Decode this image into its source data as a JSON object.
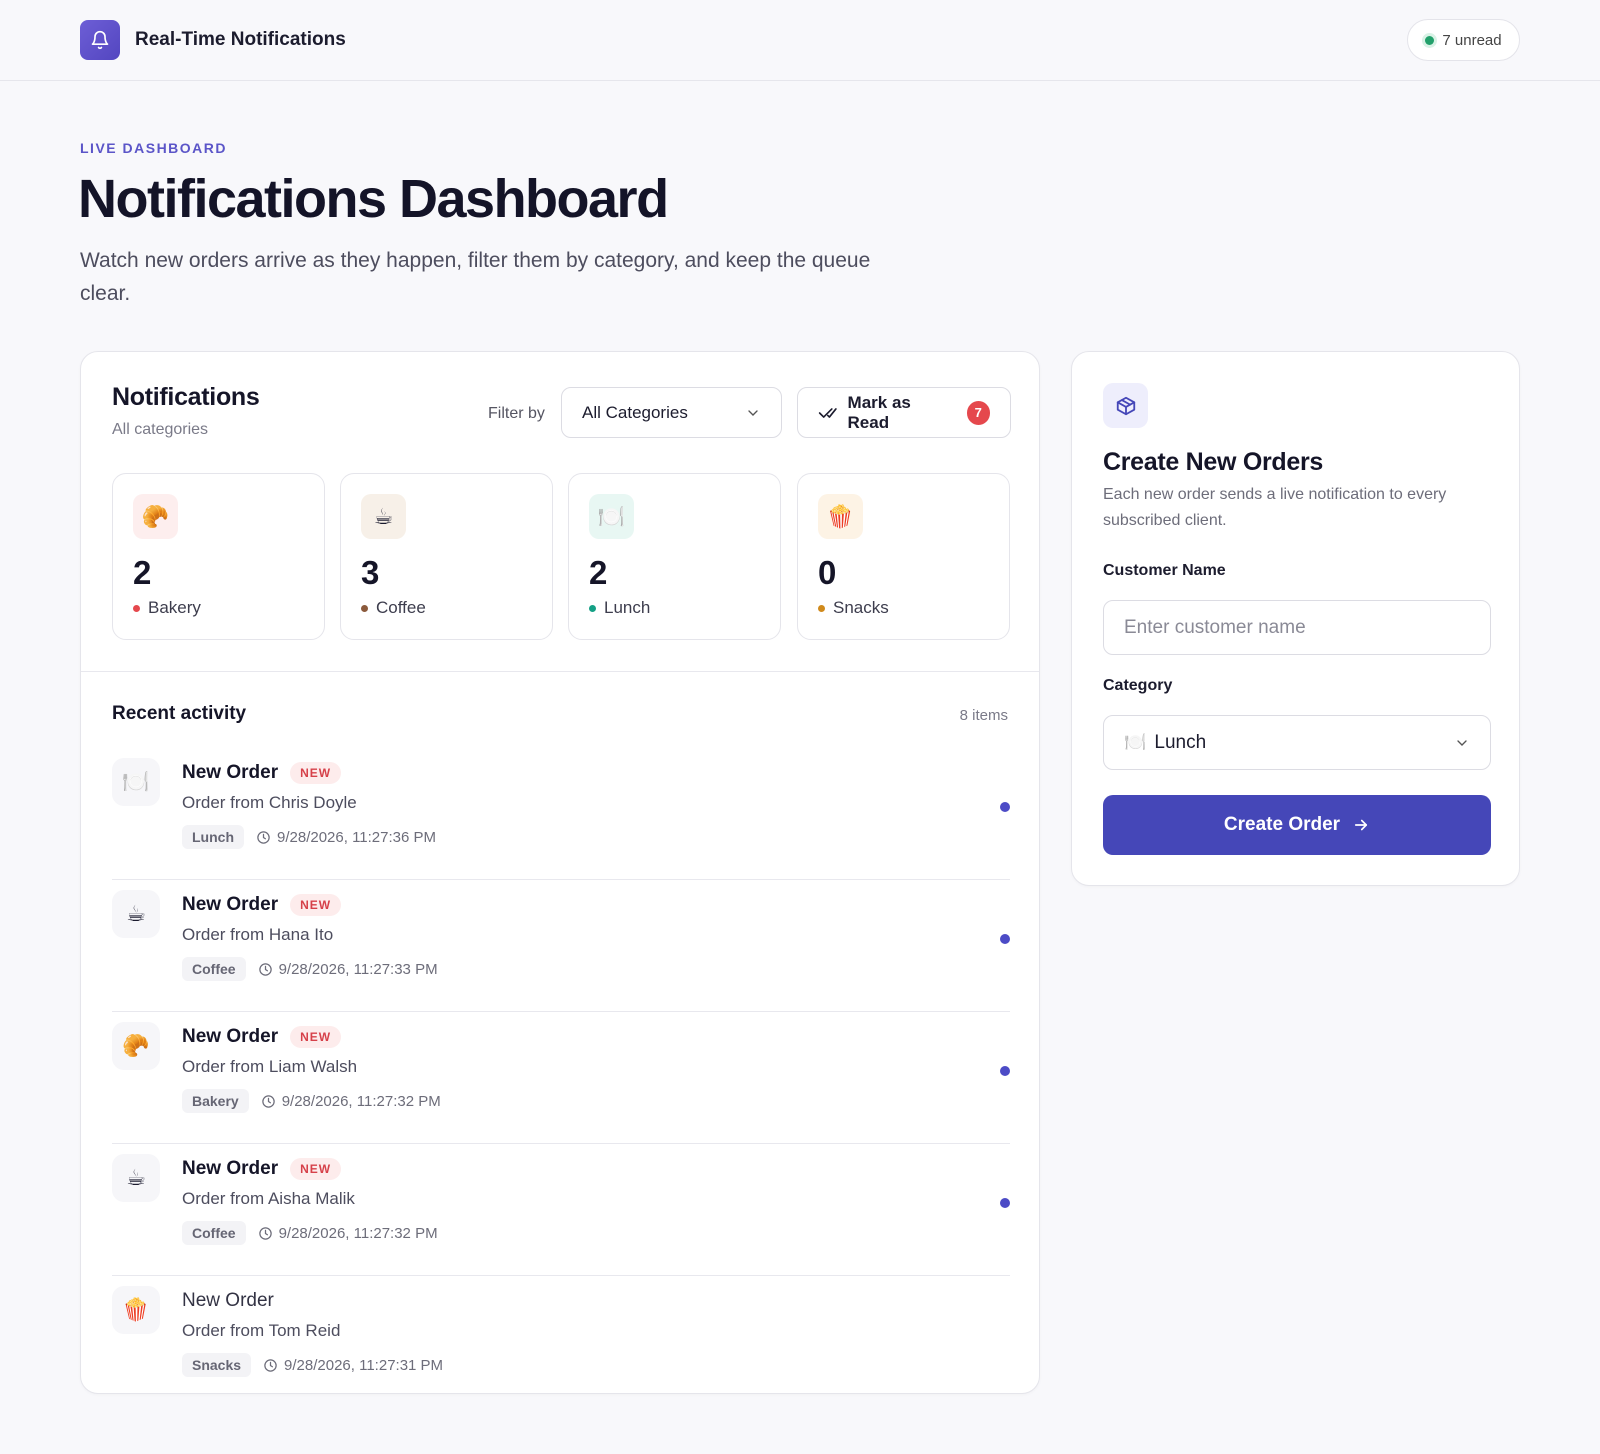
{
  "header": {
    "app_title": "Real-Time Notifications",
    "unread_label": "7 unread",
    "brand_icon": "bell-icon"
  },
  "hero": {
    "eyebrow": "LIVE DASHBOARD",
    "title": "Notifications Dashboard",
    "subtitle": "Watch new orders arrive as they happen, filter them by category, and keep the queue clear."
  },
  "notifications": {
    "title": "Notifications",
    "subtitle": "All categories",
    "filter_label": "Filter by",
    "filter_selected": "All Categories",
    "mark_read_label": "Mark as Read",
    "mark_read_count": "7",
    "stats": [
      {
        "count": "2",
        "label": "Bakery",
        "icon": "🥐",
        "icon_bg": "#fdeeee",
        "dot": "#e5484d"
      },
      {
        "count": "3",
        "label": "Coffee",
        "icon": "☕",
        "icon_bg": "#f7f0e8",
        "dot": "#8b5a3c"
      },
      {
        "count": "2",
        "label": "Lunch",
        "icon": "🍽️",
        "icon_bg": "#e8f7f3",
        "dot": "#14a085"
      },
      {
        "count": "0",
        "label": "Snacks",
        "icon": "🍿",
        "icon_bg": "#fdf3e5",
        "dot": "#d08a1c"
      }
    ],
    "recent_title": "Recent activity",
    "items_count": "8 items",
    "new_badge": "NEW",
    "activity": [
      {
        "title": "New Order",
        "desc": "Order from Chris Doyle",
        "category": "Lunch",
        "time": "9/28/2026, 11:27:36 PM",
        "icon": "🍽️",
        "unread": true
      },
      {
        "title": "New Order",
        "desc": "Order from Hana Ito",
        "category": "Coffee",
        "time": "9/28/2026, 11:27:33 PM",
        "icon": "☕",
        "unread": true
      },
      {
        "title": "New Order",
        "desc": "Order from Liam Walsh",
        "category": "Bakery",
        "time": "9/28/2026, 11:27:32 PM",
        "icon": "🥐",
        "unread": true
      },
      {
        "title": "New Order",
        "desc": "Order from Aisha Malik",
        "category": "Coffee",
        "time": "9/28/2026, 11:27:32 PM",
        "icon": "☕",
        "unread": true
      },
      {
        "title": "New Order",
        "desc": "Order from Tom Reid",
        "category": "Snacks",
        "time": "9/28/2026, 11:27:31 PM",
        "icon": "🍿",
        "unread": false
      }
    ]
  },
  "create": {
    "title": "Create New Orders",
    "subtitle": "Each new order sends a live notification to every subscribed client.",
    "customer_label": "Customer Name",
    "customer_placeholder": "Enter customer name",
    "category_label": "Category",
    "category_selected": "Lunch",
    "category_icon": "🍽️",
    "button_label": "Create Order",
    "side_icon": "package-icon"
  },
  "colors": {
    "accent": "#4547b8",
    "brand": "#5b4fcf",
    "unread_dot": "#4c4bc6",
    "online": "#22a06b",
    "badge_red": "#e5484d"
  }
}
